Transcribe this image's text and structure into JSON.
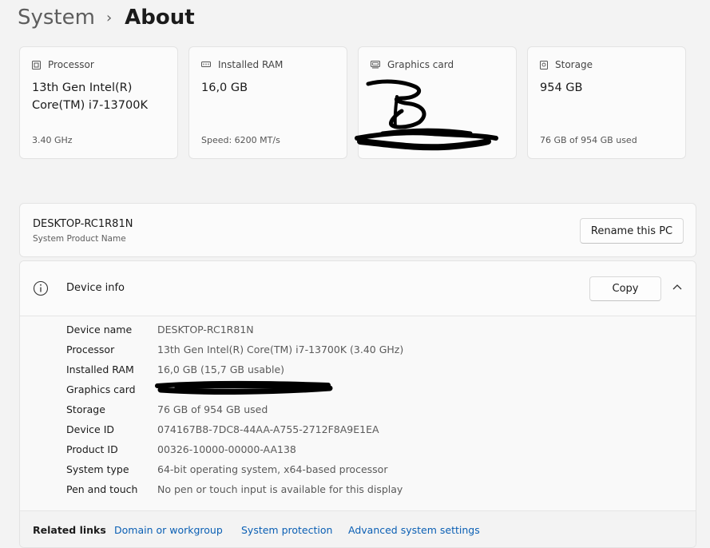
{
  "breadcrumb": {
    "parent": "System",
    "separator": "›",
    "current": "About"
  },
  "spec_cards": [
    {
      "label": "Processor",
      "icon": "processor-icon",
      "value": "13th Gen Intel(R) Core(TM) i7-13700K",
      "sub": "3.40 GHz"
    },
    {
      "label": "Installed RAM",
      "icon": "ram-icon",
      "value": "16,0 GB",
      "sub": "Speed: 6200 MT/s"
    },
    {
      "label": "Graphics card",
      "icon": "graphics-card-icon",
      "value": "",
      "sub": ""
    },
    {
      "label": "Storage",
      "icon": "storage-icon",
      "value": "954 GB",
      "sub": "76 GB of 954 GB used"
    }
  ],
  "pc_name": {
    "name": "DESKTOP-RC1R81N",
    "caption": "System Product Name",
    "rename_label": "Rename this PC"
  },
  "device_info": {
    "title": "Device info",
    "copy_label": "Copy",
    "rows": [
      {
        "key": "Device name",
        "value": "DESKTOP-RC1R81N"
      },
      {
        "key": "Processor",
        "value": "13th Gen Intel(R) Core(TM) i7-13700K (3.40 GHz)"
      },
      {
        "key": "Installed RAM",
        "value": "16,0 GB (15,7 GB usable)"
      },
      {
        "key": "Graphics card",
        "value": ""
      },
      {
        "key": "Storage",
        "value": "76 GB of 954 GB used"
      },
      {
        "key": "Device ID",
        "value": "074167B8-7DC8-44AA-A755-2712F8A9E1EA"
      },
      {
        "key": "Product ID",
        "value": "00326-10000-00000-AA138"
      },
      {
        "key": "System type",
        "value": "64-bit operating system, x64-based processor"
      },
      {
        "key": "Pen and touch",
        "value": "No pen or touch input is available for this display"
      }
    ]
  },
  "related_links": {
    "label": "Related links",
    "links": [
      "Domain or workgroup",
      "System protection",
      "Advanced system settings"
    ]
  },
  "colors": {
    "link": "#0a5fb4",
    "background": "#f3f3f3",
    "card": "#fbfbfb"
  }
}
